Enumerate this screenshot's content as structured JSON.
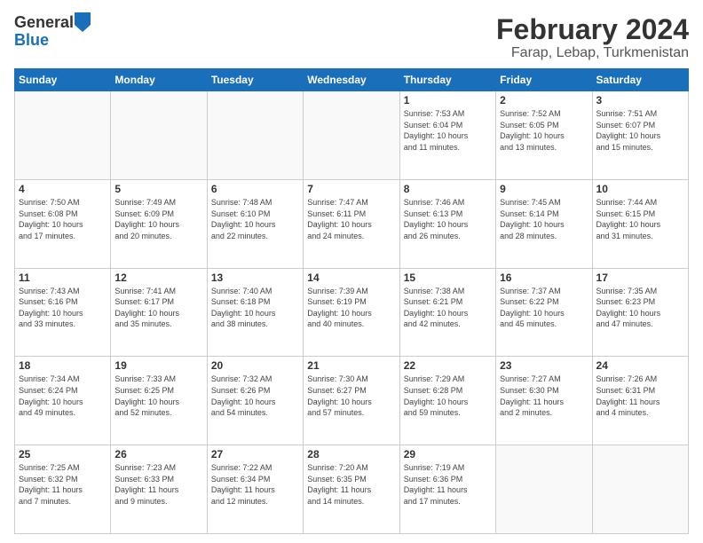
{
  "logo": {
    "general": "General",
    "blue": "Blue"
  },
  "title": "February 2024",
  "subtitle": "Farap, Lebap, Turkmenistan",
  "days_header": [
    "Sunday",
    "Monday",
    "Tuesday",
    "Wednesday",
    "Thursday",
    "Friday",
    "Saturday"
  ],
  "weeks": [
    [
      {
        "day": "",
        "info": ""
      },
      {
        "day": "",
        "info": ""
      },
      {
        "day": "",
        "info": ""
      },
      {
        "day": "",
        "info": ""
      },
      {
        "day": "1",
        "info": "Sunrise: 7:53 AM\nSunset: 6:04 PM\nDaylight: 10 hours\nand 11 minutes."
      },
      {
        "day": "2",
        "info": "Sunrise: 7:52 AM\nSunset: 6:05 PM\nDaylight: 10 hours\nand 13 minutes."
      },
      {
        "day": "3",
        "info": "Sunrise: 7:51 AM\nSunset: 6:07 PM\nDaylight: 10 hours\nand 15 minutes."
      }
    ],
    [
      {
        "day": "4",
        "info": "Sunrise: 7:50 AM\nSunset: 6:08 PM\nDaylight: 10 hours\nand 17 minutes."
      },
      {
        "day": "5",
        "info": "Sunrise: 7:49 AM\nSunset: 6:09 PM\nDaylight: 10 hours\nand 20 minutes."
      },
      {
        "day": "6",
        "info": "Sunrise: 7:48 AM\nSunset: 6:10 PM\nDaylight: 10 hours\nand 22 minutes."
      },
      {
        "day": "7",
        "info": "Sunrise: 7:47 AM\nSunset: 6:11 PM\nDaylight: 10 hours\nand 24 minutes."
      },
      {
        "day": "8",
        "info": "Sunrise: 7:46 AM\nSunset: 6:13 PM\nDaylight: 10 hours\nand 26 minutes."
      },
      {
        "day": "9",
        "info": "Sunrise: 7:45 AM\nSunset: 6:14 PM\nDaylight: 10 hours\nand 28 minutes."
      },
      {
        "day": "10",
        "info": "Sunrise: 7:44 AM\nSunset: 6:15 PM\nDaylight: 10 hours\nand 31 minutes."
      }
    ],
    [
      {
        "day": "11",
        "info": "Sunrise: 7:43 AM\nSunset: 6:16 PM\nDaylight: 10 hours\nand 33 minutes."
      },
      {
        "day": "12",
        "info": "Sunrise: 7:41 AM\nSunset: 6:17 PM\nDaylight: 10 hours\nand 35 minutes."
      },
      {
        "day": "13",
        "info": "Sunrise: 7:40 AM\nSunset: 6:18 PM\nDaylight: 10 hours\nand 38 minutes."
      },
      {
        "day": "14",
        "info": "Sunrise: 7:39 AM\nSunset: 6:19 PM\nDaylight: 10 hours\nand 40 minutes."
      },
      {
        "day": "15",
        "info": "Sunrise: 7:38 AM\nSunset: 6:21 PM\nDaylight: 10 hours\nand 42 minutes."
      },
      {
        "day": "16",
        "info": "Sunrise: 7:37 AM\nSunset: 6:22 PM\nDaylight: 10 hours\nand 45 minutes."
      },
      {
        "day": "17",
        "info": "Sunrise: 7:35 AM\nSunset: 6:23 PM\nDaylight: 10 hours\nand 47 minutes."
      }
    ],
    [
      {
        "day": "18",
        "info": "Sunrise: 7:34 AM\nSunset: 6:24 PM\nDaylight: 10 hours\nand 49 minutes."
      },
      {
        "day": "19",
        "info": "Sunrise: 7:33 AM\nSunset: 6:25 PM\nDaylight: 10 hours\nand 52 minutes."
      },
      {
        "day": "20",
        "info": "Sunrise: 7:32 AM\nSunset: 6:26 PM\nDaylight: 10 hours\nand 54 minutes."
      },
      {
        "day": "21",
        "info": "Sunrise: 7:30 AM\nSunset: 6:27 PM\nDaylight: 10 hours\nand 57 minutes."
      },
      {
        "day": "22",
        "info": "Sunrise: 7:29 AM\nSunset: 6:28 PM\nDaylight: 10 hours\nand 59 minutes."
      },
      {
        "day": "23",
        "info": "Sunrise: 7:27 AM\nSunset: 6:30 PM\nDaylight: 11 hours\nand 2 minutes."
      },
      {
        "day": "24",
        "info": "Sunrise: 7:26 AM\nSunset: 6:31 PM\nDaylight: 11 hours\nand 4 minutes."
      }
    ],
    [
      {
        "day": "25",
        "info": "Sunrise: 7:25 AM\nSunset: 6:32 PM\nDaylight: 11 hours\nand 7 minutes."
      },
      {
        "day": "26",
        "info": "Sunrise: 7:23 AM\nSunset: 6:33 PM\nDaylight: 11 hours\nand 9 minutes."
      },
      {
        "day": "27",
        "info": "Sunrise: 7:22 AM\nSunset: 6:34 PM\nDaylight: 11 hours\nand 12 minutes."
      },
      {
        "day": "28",
        "info": "Sunrise: 7:20 AM\nSunset: 6:35 PM\nDaylight: 11 hours\nand 14 minutes."
      },
      {
        "day": "29",
        "info": "Sunrise: 7:19 AM\nSunset: 6:36 PM\nDaylight: 11 hours\nand 17 minutes."
      },
      {
        "day": "",
        "info": ""
      },
      {
        "day": "",
        "info": ""
      }
    ]
  ]
}
